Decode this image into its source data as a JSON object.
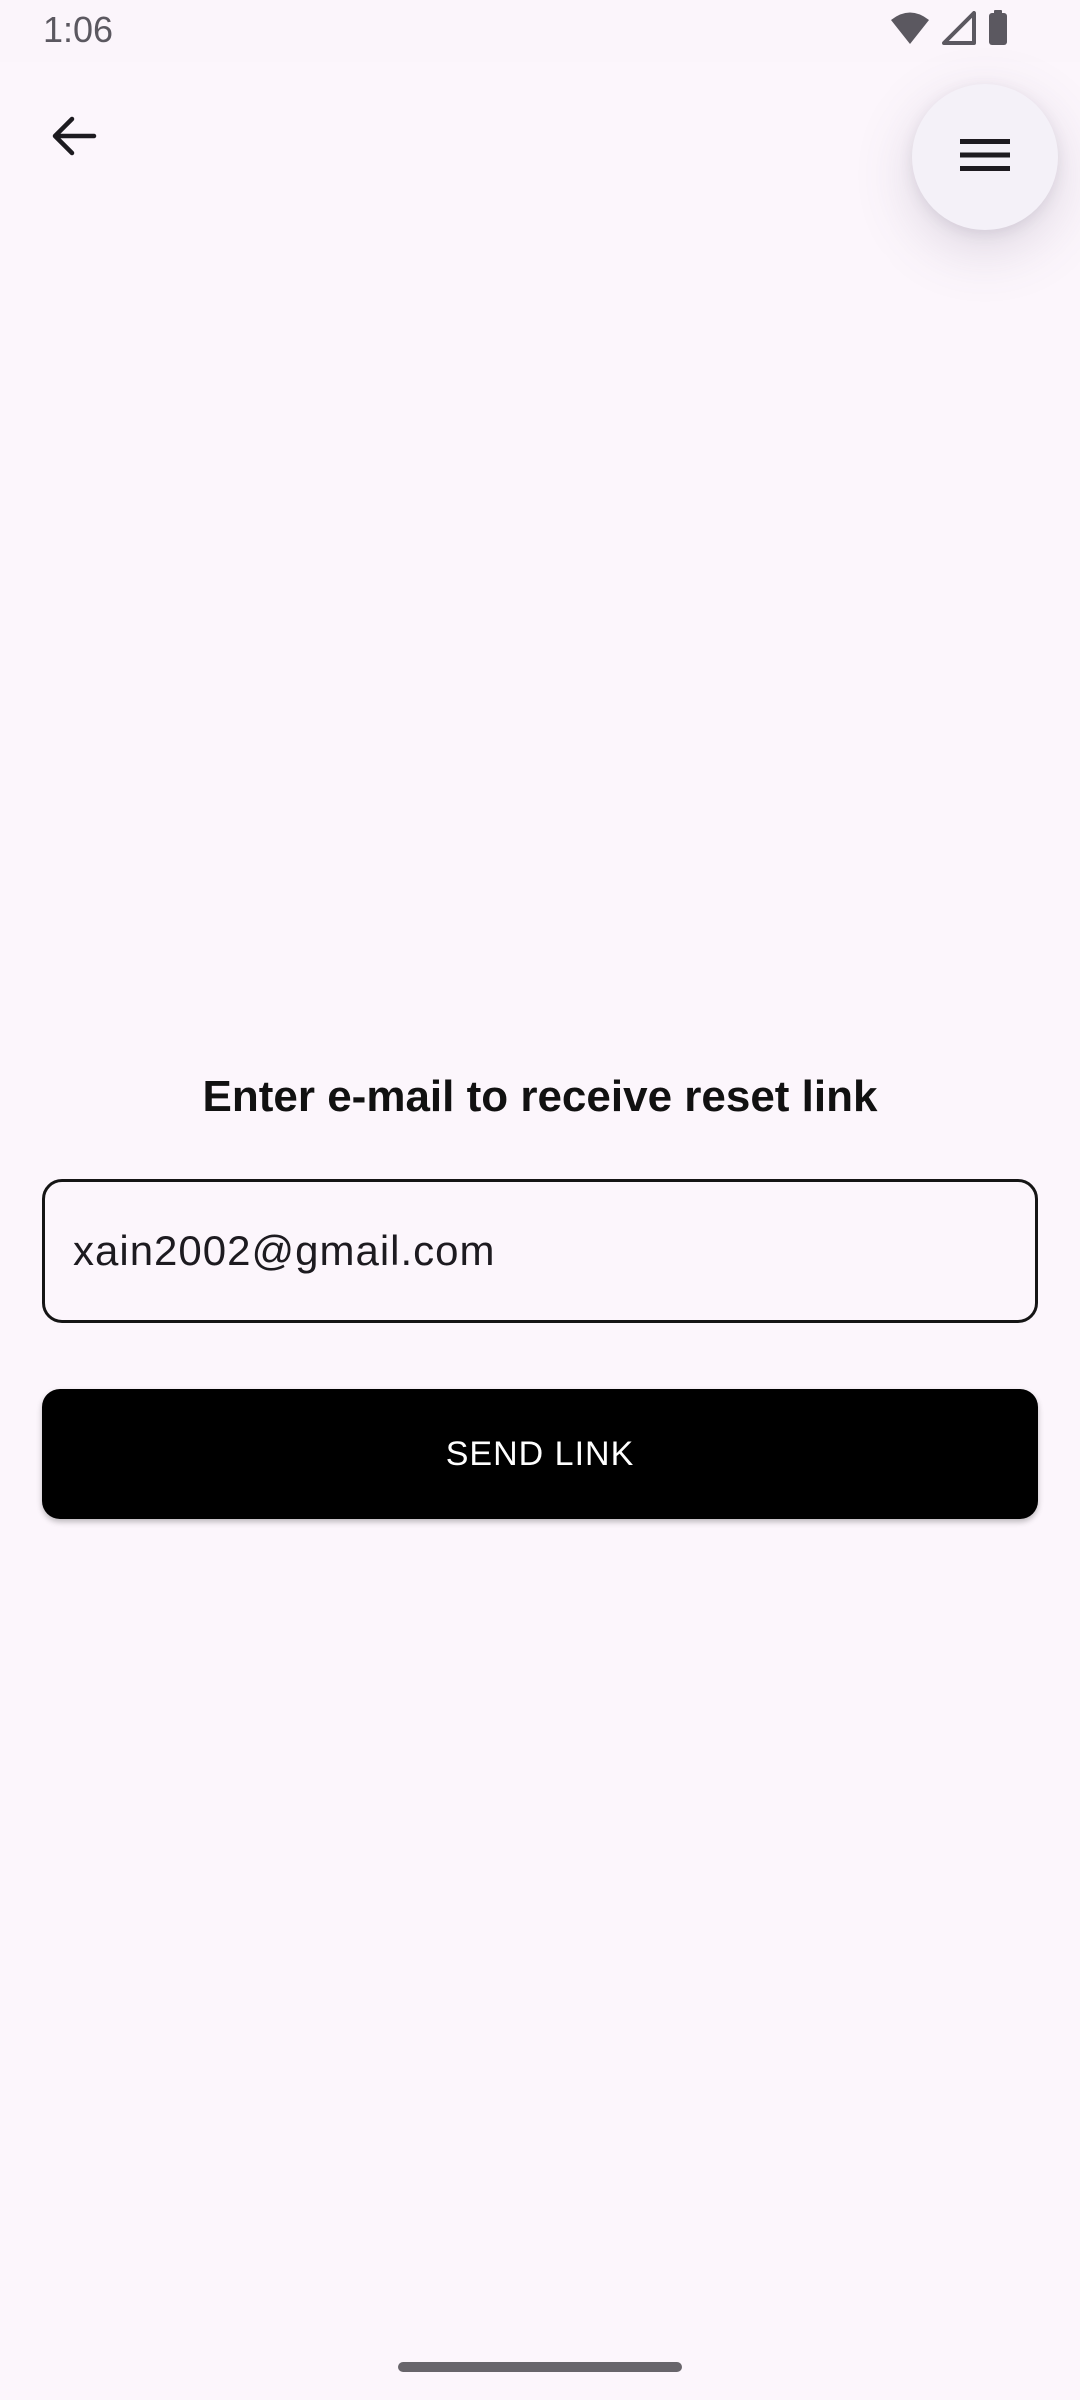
{
  "status_bar": {
    "time": "1:06",
    "icons": [
      "wifi-icon",
      "cell-signal-icon",
      "battery-icon"
    ]
  },
  "toolbar": {
    "back_icon": "arrow-left-icon",
    "menu_icon": "hamburger-menu-icon"
  },
  "form": {
    "title": "Enter e-mail to receive reset link",
    "email_value": "xain2002@gmail.com",
    "send_label": "SEND LINK"
  },
  "colors": {
    "background": "#fcf6fc",
    "button": "#000000",
    "button_text": "#ffffff",
    "text": "#111111"
  }
}
